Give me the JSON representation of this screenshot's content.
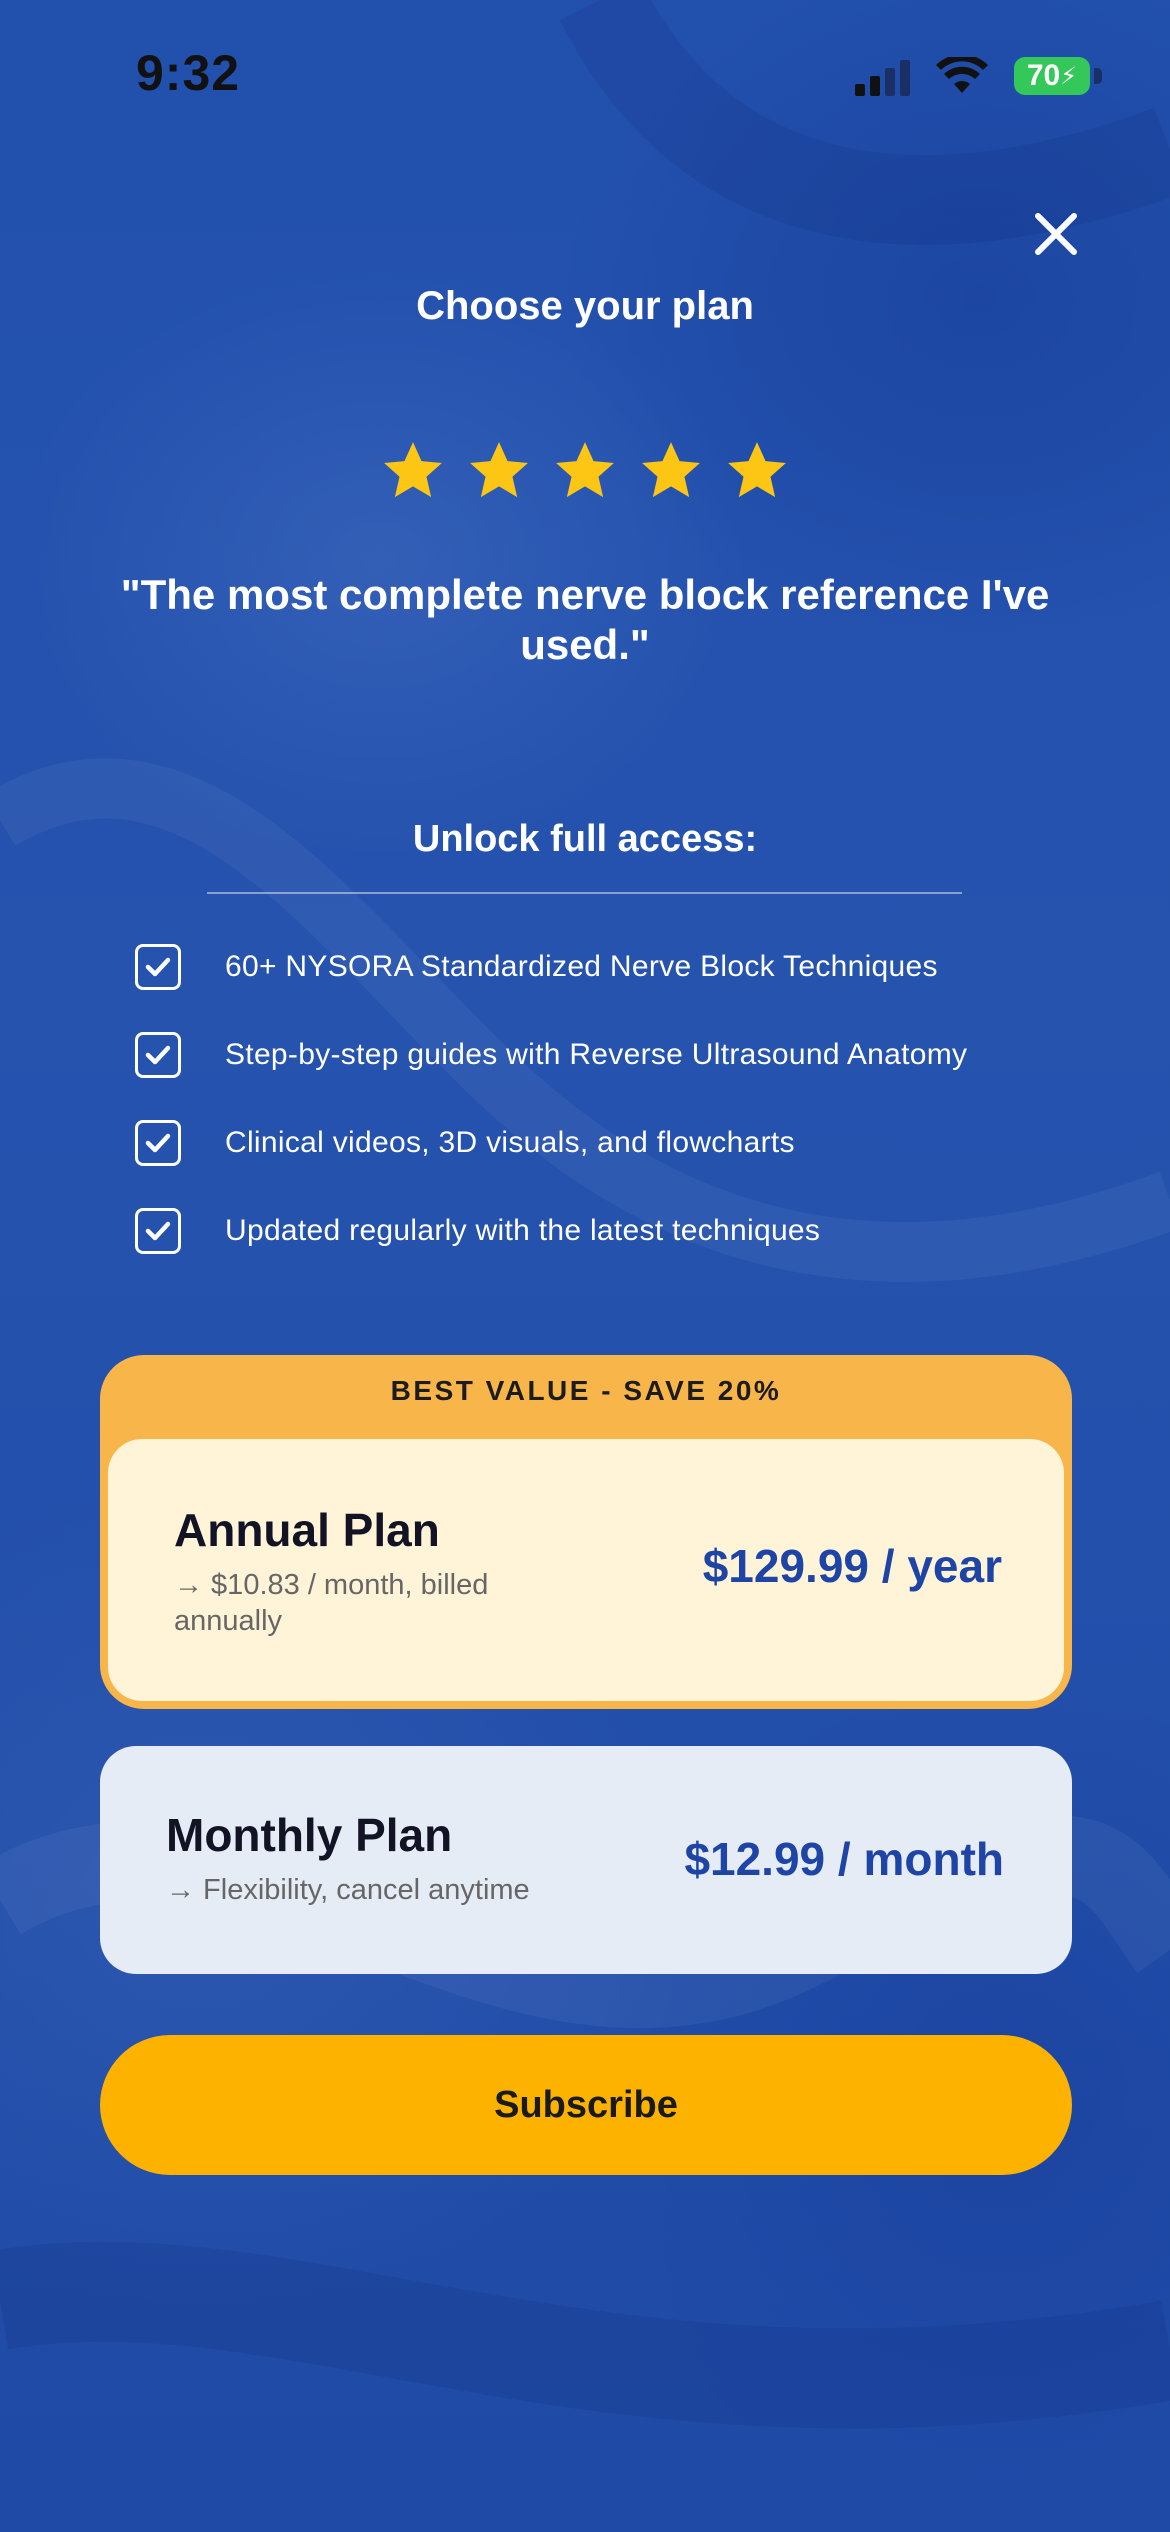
{
  "status_bar": {
    "time": "9:32",
    "battery": "70"
  },
  "header": {
    "title": "Choose your plan",
    "close_icon": "close-icon"
  },
  "rating": {
    "stars": 5,
    "star_color": "#fdc514",
    "quote": "\"The most complete nerve block reference I've used.\""
  },
  "unlock": {
    "title": "Unlock full access:",
    "features": [
      "60+ NYSORA Standardized Nerve Block Techniques",
      "Step-by-step guides with Reverse Ultrasound Anatomy",
      "Clinical videos, 3D visuals, and flowcharts",
      "Updated regularly with the latest techniques"
    ]
  },
  "plans": {
    "annual": {
      "badge": "BEST VALUE - SAVE 20%",
      "name": "Annual Plan",
      "subtitle": "→ $10.83 / month, billed annually",
      "price": "$129.99 / year",
      "selected": true
    },
    "monthly": {
      "name": "Monthly Plan",
      "subtitle": "→ Flexibility, cancel anytime",
      "price": "$12.99 / month"
    }
  },
  "cta": {
    "subscribe_label": "Subscribe"
  },
  "colors": {
    "background": "#2450a8",
    "accent": "#fdb200",
    "badge": "#f7b54a",
    "price": "#1e44a6"
  }
}
